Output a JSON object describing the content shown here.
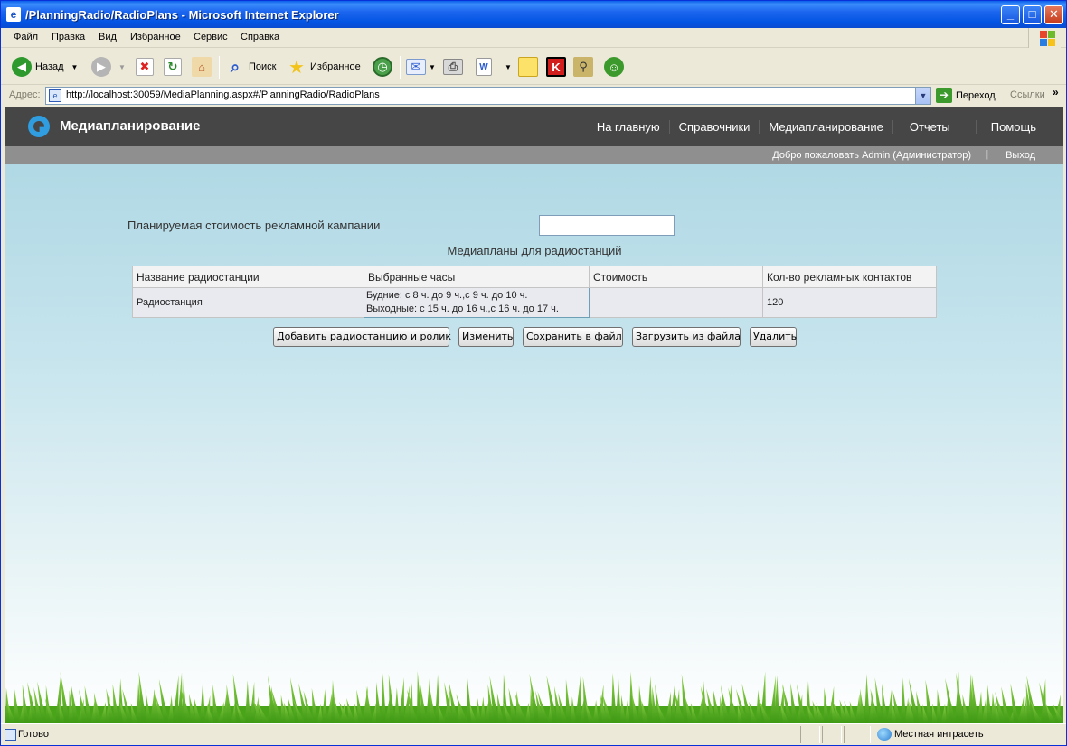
{
  "window": {
    "title": "/PlanningRadio/RadioPlans - Microsoft Internet Explorer",
    "minimize": "_",
    "maximize": "□",
    "close": "✕"
  },
  "menubar": {
    "items": [
      "Файл",
      "Правка",
      "Вид",
      "Избранное",
      "Сервис",
      "Справка"
    ]
  },
  "toolbar": {
    "back_label": "Назад",
    "search_label": "Поиск",
    "favorites_label": "Избранное"
  },
  "addressbar": {
    "label": "Адрес:",
    "url": "http://localhost:30059/MediaPlanning.aspx#/PlanningRadio/RadioPlans",
    "go_label": "Переход",
    "links_label": "Ссылки",
    "links_more": "»"
  },
  "site": {
    "title": "Медиапланирование",
    "nav": [
      "На главную",
      "Справочники",
      "Медиапланирование",
      "Отчеты",
      "Помощь"
    ],
    "welcome": "Добро пожаловать Admin (Администратор)",
    "separator": "|",
    "logout": "Выход"
  },
  "form": {
    "cost_label": "Планируемая стоимость рекламной кампании",
    "cost_value": "",
    "caption": "Медиапланы для радиостанций"
  },
  "table": {
    "headers": [
      "Название радиостанции",
      "Выбранные часы",
      "Стоимость",
      "Кол-во рекламных контактов"
    ],
    "rows": [
      {
        "station": "Радиостанция",
        "hours_weekdays": "Будние: с 8 ч. до 9 ч.,с 9 ч. до 10 ч.",
        "hours_weekends": "Выходные: с 15 ч. до 16 ч.,с 16 ч. до 17 ч.",
        "cost": "",
        "contacts": "120"
      }
    ]
  },
  "buttons": {
    "add": "Добавить радиостанцию и ролик",
    "edit": "Изменить",
    "save": "Сохранить в файл",
    "load": "Загрузить из файла",
    "delete": "Удалить"
  },
  "statusbar": {
    "status": "Готово",
    "zone": "Местная интрасеть"
  },
  "colors": {
    "header_bg": "#464646",
    "subbar_bg": "#8f8f8f",
    "logo_accent": "#2f9de0",
    "xp_titlebar": "#0354e3"
  }
}
